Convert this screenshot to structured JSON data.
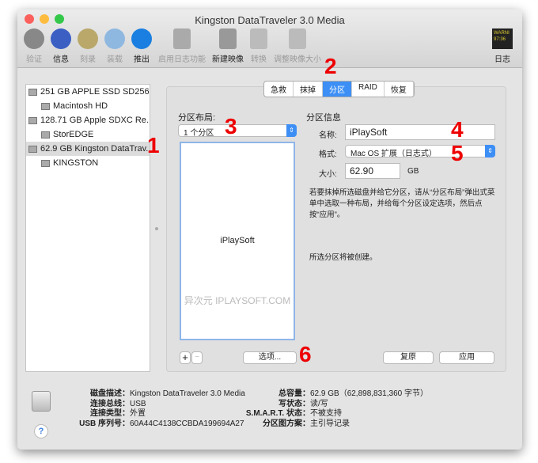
{
  "window": {
    "title": "Kingston DataTraveler 3.0 Media"
  },
  "toolbar": [
    {
      "label": "验证",
      "icon": "microscope-icon",
      "enabled": false,
      "color": "#888"
    },
    {
      "label": "信息",
      "icon": "info-icon",
      "enabled": true,
      "color": "#3c5fc4"
    },
    {
      "label": "刻录",
      "icon": "burn-icon",
      "enabled": false,
      "color": "#b9a86a"
    },
    {
      "label": "装载",
      "icon": "mount-icon",
      "enabled": false,
      "color": "#8fb8e0"
    },
    {
      "label": "推出",
      "icon": "eject-icon",
      "enabled": true,
      "color": "#1a7fe0"
    },
    {
      "label": "启用日志功能",
      "icon": "enable-journaling-icon",
      "enabled": false,
      "color": "#aaa"
    },
    {
      "label": "新建映像",
      "icon": "new-image-icon",
      "enabled": true,
      "color": "#999"
    },
    {
      "label": "转换",
      "icon": "convert-icon",
      "enabled": false,
      "color": "#bbb"
    },
    {
      "label": "调整映像大小",
      "icon": "resize-image-icon",
      "enabled": false,
      "color": "#bbb"
    }
  ],
  "log": {
    "label": "日志",
    "icon_text": "WARNI 97:36"
  },
  "sidebar": [
    {
      "label": "251 GB APPLE SSD SD256.",
      "indent": false,
      "selected": false
    },
    {
      "label": "Macintosh HD",
      "indent": true,
      "selected": false
    },
    {
      "label": "128.71 GB Apple SDXC Re.",
      "indent": false,
      "selected": false
    },
    {
      "label": "StorEDGE",
      "indent": true,
      "selected": false
    },
    {
      "label": "62.9 GB Kingston DataTrav.",
      "indent": false,
      "selected": true
    },
    {
      "label": "KINGSTON",
      "indent": true,
      "selected": false
    }
  ],
  "tabs": [
    {
      "label": "急救"
    },
    {
      "label": "抹掉"
    },
    {
      "label": "分区",
      "active": true
    },
    {
      "label": "RAID"
    },
    {
      "label": "恢复"
    }
  ],
  "partition": {
    "layout_label": "分区布局:",
    "layout_value": "1 个分区",
    "map_partition": "iPlaySoft",
    "watermark": "异次元 IPLAYSOFT.COM",
    "add": "+",
    "remove": "−",
    "options": "选项...",
    "info_label": "分区信息",
    "name_label": "名称:",
    "name_value": "iPlaySoft",
    "format_label": "格式:",
    "format_value": "Mac OS 扩展（日志式）",
    "size_label": "大小:",
    "size_value": "62.90",
    "size_unit": "GB",
    "help": "若要抹掉所选磁盘并给它分区，请从“分区布局”弹出式菜单中选取一种布局，并给每个分区设定选项，然后点按“应用”。",
    "status": "所选分区将被创建。",
    "revert": "复原",
    "apply": "应用"
  },
  "annotations": [
    "1",
    "2",
    "3",
    "4",
    "5",
    "6"
  ],
  "disk_info": {
    "left": [
      [
        "磁盘描述：",
        "Kingston DataTraveler 3.0 Media"
      ],
      [
        "连接总线：",
        "USB"
      ],
      [
        "连接类型：",
        "外置"
      ],
      [
        "USB 序列号：",
        "60A44C4138CCBDA199694A27"
      ]
    ],
    "right": [
      [
        "总容量：",
        "62.9 GB（62,898,831,360 字节）"
      ],
      [
        "写状态：",
        "读/写"
      ],
      [
        "S.M.A.R.T. 状态：",
        "不被支持"
      ],
      [
        "分区图方案：",
        "主引导记录"
      ]
    ],
    "help": "?"
  },
  "colors": {
    "accent": "#3d8ff5",
    "annotation": "#e00000"
  }
}
